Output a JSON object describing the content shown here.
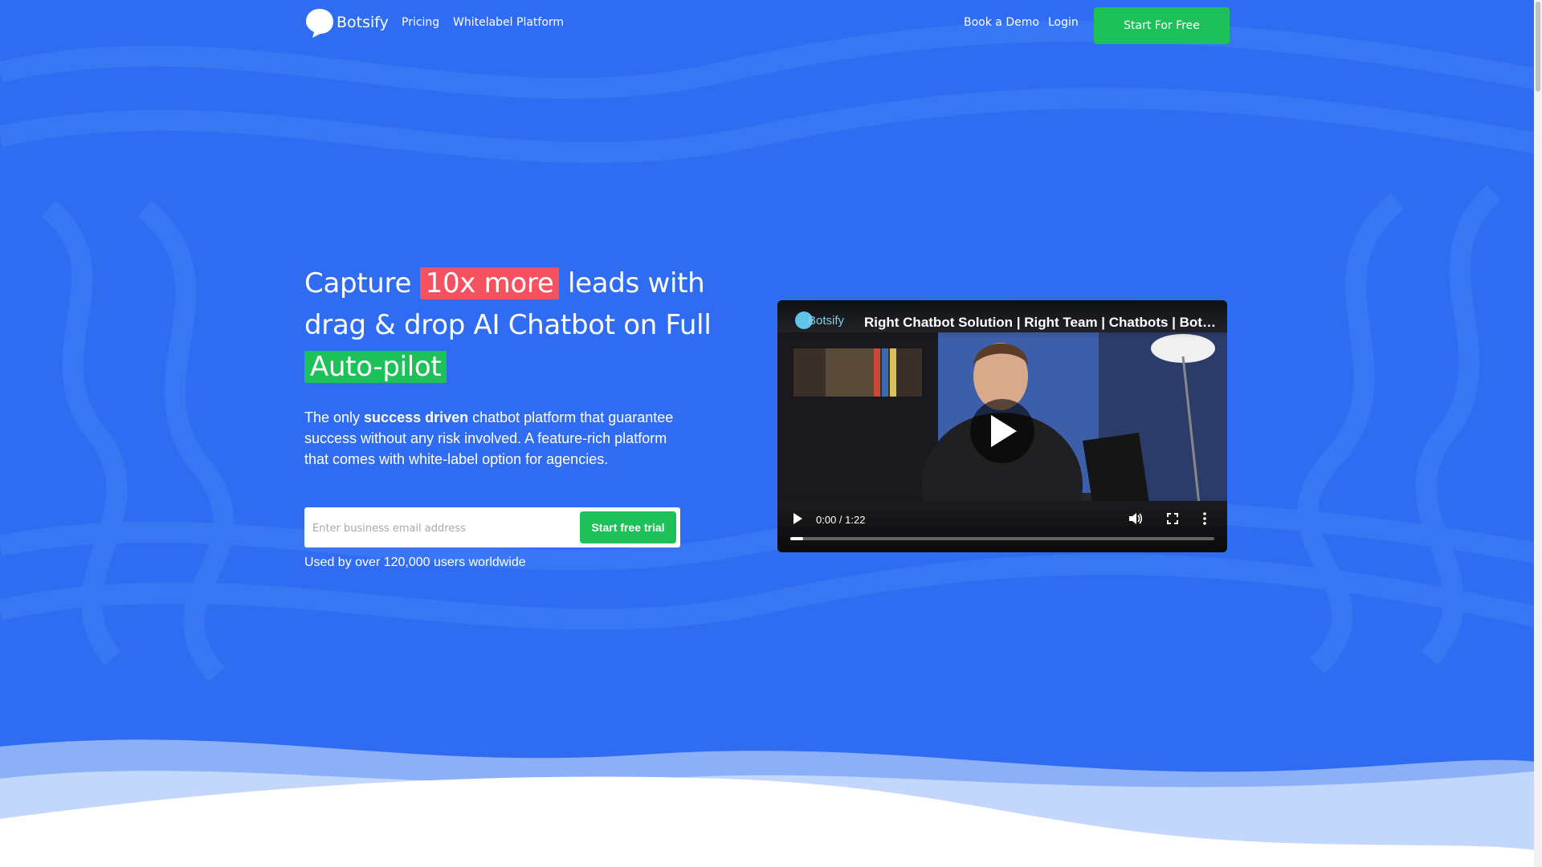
{
  "nav": {
    "brand": "Botsify",
    "links": [
      "Pricing",
      "Whitelabel Platform"
    ],
    "right_links": [
      "Book a Demo",
      "Login"
    ],
    "cta": "Start For Free"
  },
  "hero": {
    "title_part1": "Capture ",
    "title_highlight1": "10x more",
    "title_part2": " leads with drag & drop AI Chatbot on Full ",
    "title_highlight2": "Auto-pilot",
    "sub_part1": "The only ",
    "sub_bold": "success driven",
    "sub_part2": " chatbot platform that guarantee success without any risk involved. A feature-rich platform that comes with white-label option for agencies.",
    "email_placeholder": "Enter business email address",
    "trial_button": "Start free trial",
    "users_text": "Used by over 120,000 users worldwide"
  },
  "video": {
    "channel": "Botsify",
    "title": "Right Chatbot Solution | Right Team | Chatbots | Botsify",
    "time": "0:00 / 1:22",
    "progress": 0.03
  },
  "colors": {
    "background": "#2f6cf2",
    "accent_green": "#1ec05a",
    "accent_red": "#f6515f"
  },
  "icons": [
    "logo-icon",
    "play-icon",
    "volume-icon",
    "fullscreen-icon",
    "more-options-icon"
  ]
}
